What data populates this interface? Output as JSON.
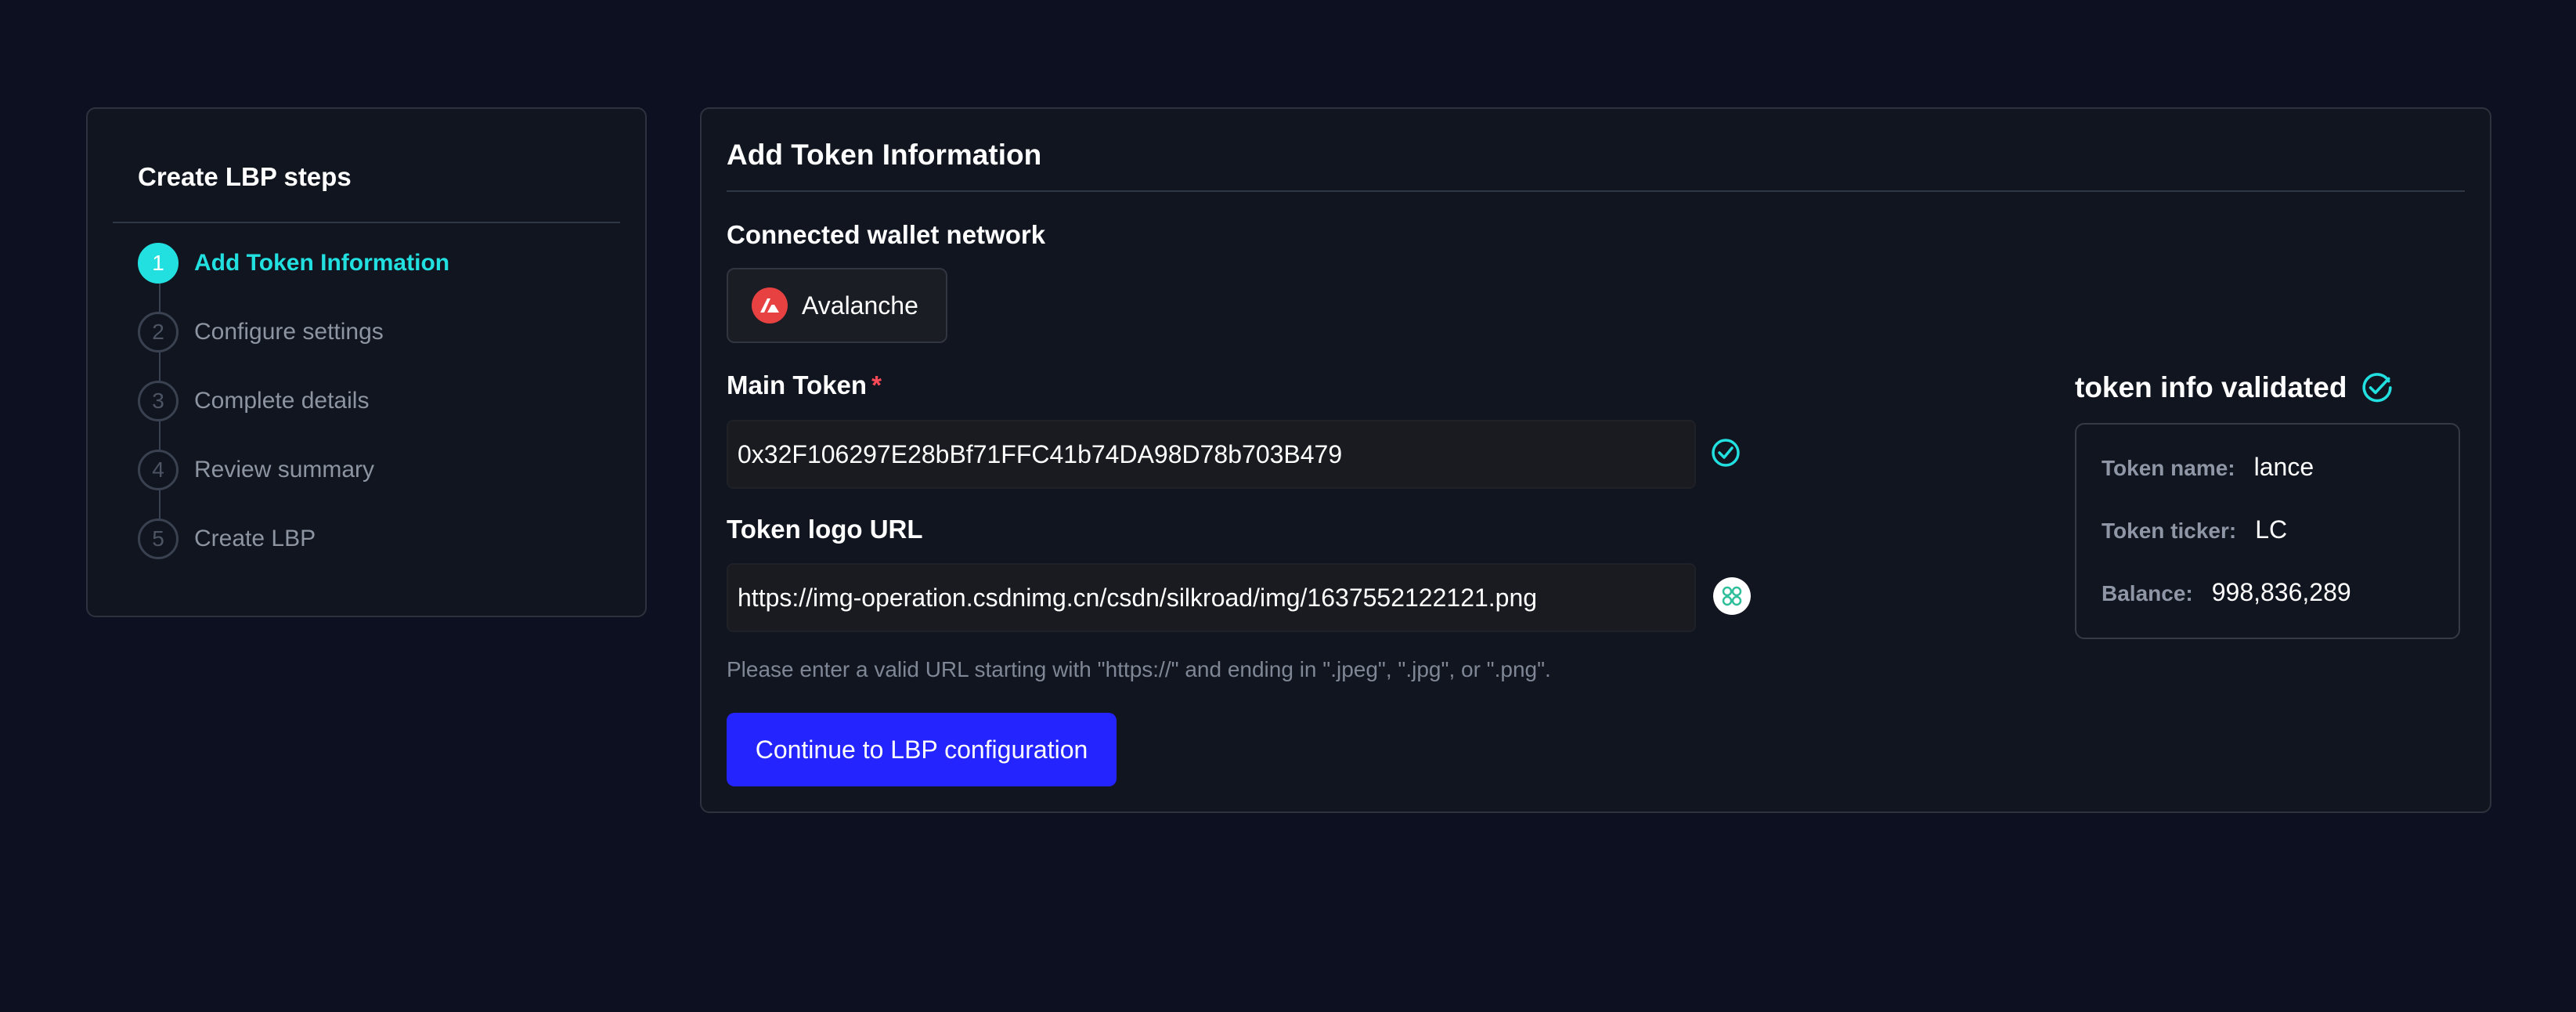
{
  "sidebar": {
    "title": "Create LBP steps",
    "steps": [
      {
        "number": "1",
        "label": "Add Token Information",
        "active": true
      },
      {
        "number": "2",
        "label": "Configure settings",
        "active": false
      },
      {
        "number": "3",
        "label": "Complete details",
        "active": false
      },
      {
        "number": "4",
        "label": "Review summary",
        "active": false
      },
      {
        "number": "5",
        "label": "Create LBP",
        "active": false
      }
    ]
  },
  "main": {
    "title": "Add Token Information",
    "network": {
      "label": "Connected wallet network",
      "name": "Avalanche",
      "icon": "avalanche-logo-icon"
    },
    "main_token": {
      "label": "Main Token",
      "required_mark": "*",
      "value": "0x32F106297E28bBf71FFC41b74DA98D78b703B479",
      "status_icon": "check-circle-icon"
    },
    "token_logo": {
      "label": "Token logo URL",
      "value": "https://img-operation.csdnimg.cn/csdn/silkroad/img/1637552122121.png",
      "preview_icon": "token-logo-preview-icon"
    },
    "hint": "Please enter a valid URL starting with \"https://\" and ending in \".jpeg\", \".jpg\", or \".png\".",
    "continue_label": "Continue to LBP configuration"
  },
  "validation": {
    "title": "token info validated",
    "icon": "check-circle-icon",
    "rows": [
      {
        "key": "Token name:",
        "value": "lance"
      },
      {
        "key": "Token ticker:",
        "value": "LC"
      },
      {
        "key": "Balance:",
        "value": "998,836,289"
      }
    ]
  },
  "colors": {
    "background": "#0c1020",
    "card": "#11151f",
    "accent_cyan": "#22e0e0",
    "primary_button": "#2424ff",
    "required": "#ff4a5a",
    "avalanche_red": "#e84142"
  }
}
